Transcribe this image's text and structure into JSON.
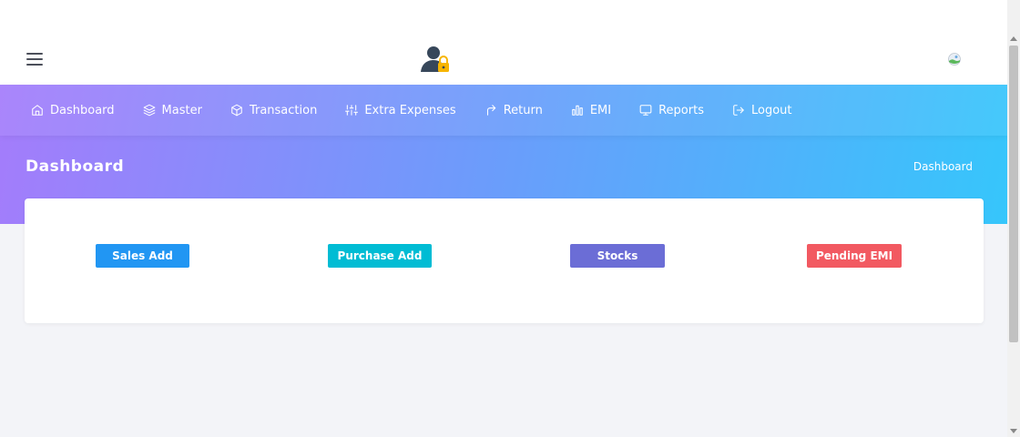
{
  "nav": {
    "items": [
      {
        "label": "Dashboard",
        "icon": "home-icon"
      },
      {
        "label": "Master",
        "icon": "layers-icon"
      },
      {
        "label": "Transaction",
        "icon": "box-icon"
      },
      {
        "label": "Extra Expenses",
        "icon": "sliders-icon"
      },
      {
        "label": "Return",
        "icon": "return-arrow-icon"
      },
      {
        "label": "EMI",
        "icon": "bar-chart-icon"
      },
      {
        "label": "Reports",
        "icon": "monitor-icon"
      },
      {
        "label": "Logout",
        "icon": "logout-icon"
      }
    ]
  },
  "header": {
    "title": "Dashboard",
    "breadcrumb": "Dashboard"
  },
  "actions": {
    "sales_add": "Sales Add",
    "purchase_add": "Purchase Add",
    "stocks": "Stocks",
    "pending_emi": "Pending EMI"
  },
  "colors": {
    "gradient_start": "#a47cfb",
    "gradient_end": "#36c6fb",
    "sales": "#2196f3",
    "purchase": "#00bcd4",
    "stocks": "#6b6dd6",
    "pending_emi": "#f25961"
  }
}
